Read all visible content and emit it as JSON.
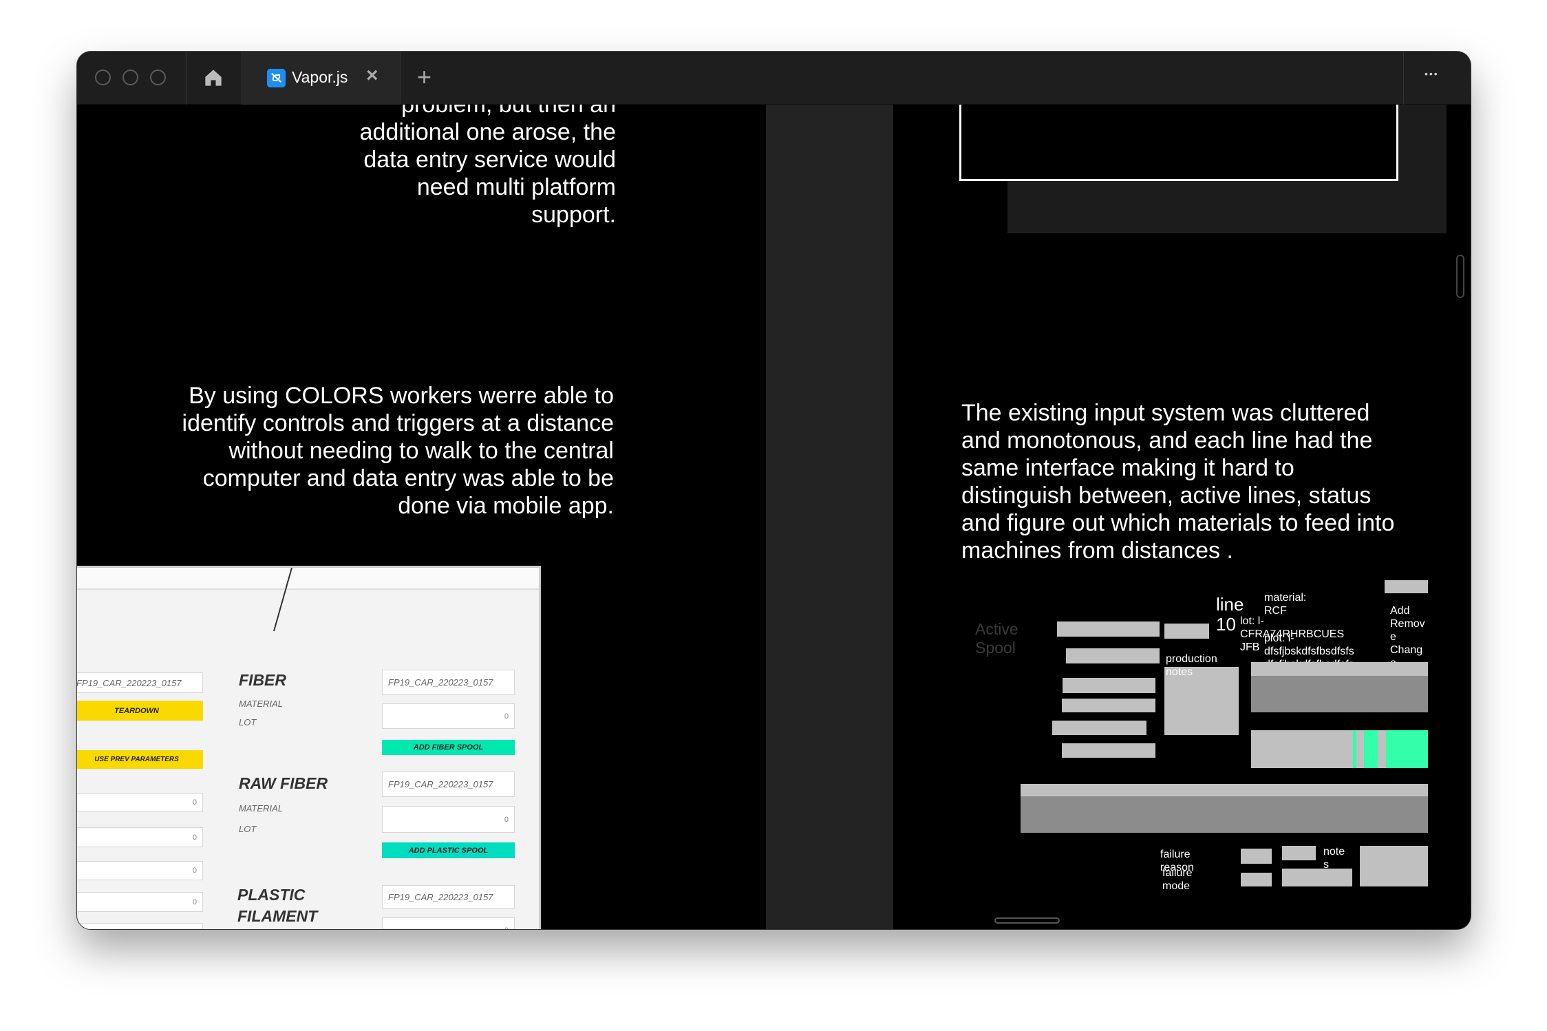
{
  "browser": {
    "tab_title": "Vapor.js",
    "close_glyph": "×",
    "new_tab_glyph": "+",
    "menu_glyph": "•••",
    "icons": [
      "traffic-light-icon",
      "home-icon",
      "vapor-logo-icon",
      "close-icon",
      "plus-icon",
      "more-icon"
    ]
  },
  "left": {
    "para1": [
      "problem, but then an",
      "additional one arose, the",
      "data entry  service would",
      "need multi platform",
      "support."
    ],
    "para2": [
      "By using COLORS workers werre able to",
      "identify controls and triggers at a distance",
      "without needing to walk to the central",
      "computer and data entry was able to be",
      "done via mobile app."
    ]
  },
  "mockup": {
    "left_input": "FP19_CAR_220223_0157",
    "teardown": "TEARDOWN",
    "use_prev": "USE PREV PARAMETERS",
    "zero": "0",
    "fiber": "FIBER",
    "raw_fiber": "RAW FIBER",
    "plastic": "PLASTIC",
    "filament": "FILAMENT",
    "material": "MATERIAL",
    "lot": "LOT",
    "fiber_input": "FP19_CAR_220223_0157",
    "add_fiber": "ADD FIBER SPOOL",
    "add_plastic": "ADD PLASTIC SPOOL",
    "colors": {
      "yellow": "#f9d900",
      "green": "#00e8b0",
      "teal": "#00dcc0"
    }
  },
  "right": {
    "para": [
      "The existing input system was cluttered",
      "and monotonous, and each line had the",
      "same interface making it hard to",
      "distinguish between, active lines, status",
      "and figure out which materials to feed into",
      "machines from distances ."
    ]
  },
  "wireframe": {
    "active_spool": [
      "Active",
      "Spool"
    ],
    "line": [
      "line",
      "10"
    ],
    "material": [
      "material:",
      "RCF"
    ],
    "lot": [
      "lot: l-",
      "CFRA74RHRBCUES",
      "JFB"
    ],
    "plot": [
      "plot: l-",
      "dfsfjbskdfsfbsdfsfs",
      "dfsfjbskdfsfbsdfsfs"
    ],
    "production_notes": [
      "production",
      "notes"
    ],
    "add_remove": [
      "Add",
      "Remov",
      "e",
      "Chang",
      "e"
    ],
    "failure_reason": [
      "failure",
      "reason"
    ],
    "failure_mode": [
      "failure",
      "mode"
    ],
    "notes": [
      "note",
      "s"
    ],
    "accent": "#33ffaa"
  }
}
